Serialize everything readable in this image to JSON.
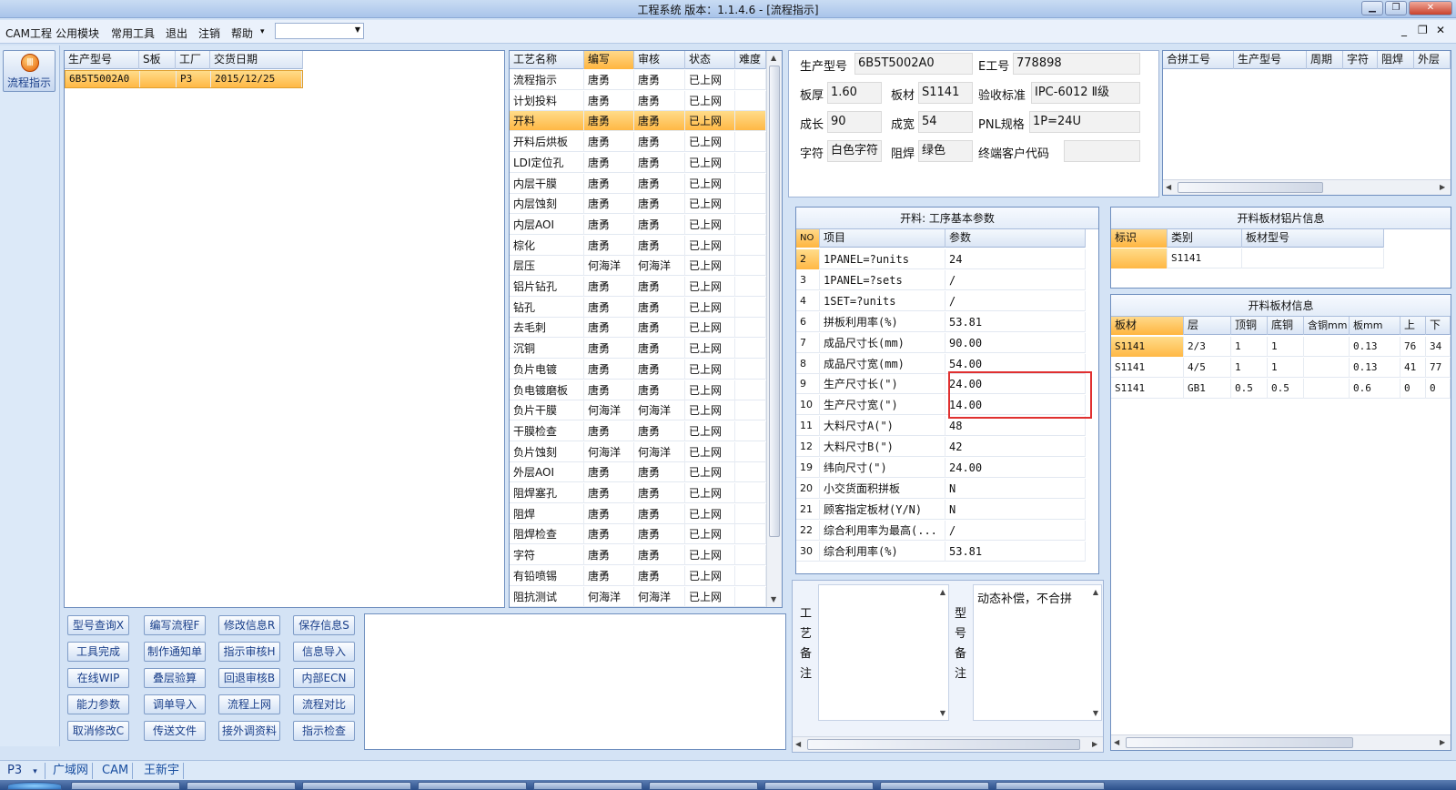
{
  "window": {
    "title": "工程系统   版本：1.1.4.6 - [流程指示]"
  },
  "menu": {
    "items": [
      "CAM工程",
      "公用模块",
      "常用工具",
      "退出",
      "注销",
      "帮助"
    ],
    "help_arrow": "▾",
    "combo_value": ""
  },
  "sidebar": {
    "flow_label": "流程指示"
  },
  "orders": {
    "columns": [
      "生产型号",
      "S板",
      "工厂",
      "交货日期"
    ],
    "rows": [
      {
        "model": "6B5T5002A0",
        "s": "",
        "factory": "P3",
        "date": "2015/12/25"
      }
    ]
  },
  "process": {
    "columns": [
      "工艺名称",
      "编写",
      "审核",
      "状态",
      "难度"
    ],
    "selected_index": 2,
    "rows": [
      [
        "流程指示",
        "唐勇",
        "唐勇",
        "已上网",
        ""
      ],
      [
        "计划投料",
        "唐勇",
        "唐勇",
        "已上网",
        ""
      ],
      [
        "开料",
        "唐勇",
        "唐勇",
        "已上网",
        ""
      ],
      [
        "开料后烘板",
        "唐勇",
        "唐勇",
        "已上网",
        ""
      ],
      [
        "LDI定位孔",
        "唐勇",
        "唐勇",
        "已上网",
        ""
      ],
      [
        "内层干膜",
        "唐勇",
        "唐勇",
        "已上网",
        ""
      ],
      [
        "内层蚀刻",
        "唐勇",
        "唐勇",
        "已上网",
        ""
      ],
      [
        "内层AOI",
        "唐勇",
        "唐勇",
        "已上网",
        ""
      ],
      [
        "棕化",
        "唐勇",
        "唐勇",
        "已上网",
        ""
      ],
      [
        "层压",
        "何海洋",
        "何海洋",
        "已上网",
        ""
      ],
      [
        "铝片钻孔",
        "唐勇",
        "唐勇",
        "已上网",
        ""
      ],
      [
        "钻孔",
        "唐勇",
        "唐勇",
        "已上网",
        ""
      ],
      [
        "去毛刺",
        "唐勇",
        "唐勇",
        "已上网",
        ""
      ],
      [
        "沉铜",
        "唐勇",
        "唐勇",
        "已上网",
        ""
      ],
      [
        "负片电镀",
        "唐勇",
        "唐勇",
        "已上网",
        ""
      ],
      [
        "负电镀磨板",
        "唐勇",
        "唐勇",
        "已上网",
        ""
      ],
      [
        "负片干膜",
        "何海洋",
        "何海洋",
        "已上网",
        ""
      ],
      [
        "干膜检查",
        "唐勇",
        "唐勇",
        "已上网",
        ""
      ],
      [
        "负片蚀刻",
        "何海洋",
        "何海洋",
        "已上网",
        ""
      ],
      [
        "外层AOI",
        "唐勇",
        "唐勇",
        "已上网",
        ""
      ],
      [
        "阻焊塞孔",
        "唐勇",
        "唐勇",
        "已上网",
        ""
      ],
      [
        "阻焊",
        "唐勇",
        "唐勇",
        "已上网",
        ""
      ],
      [
        "阻焊检查",
        "唐勇",
        "唐勇",
        "已上网",
        ""
      ],
      [
        "字符",
        "唐勇",
        "唐勇",
        "已上网",
        ""
      ],
      [
        "有铅喷锡",
        "唐勇",
        "唐勇",
        "已上网",
        ""
      ],
      [
        "阻抗测试",
        "何海洋",
        "何海洋",
        "已上网",
        ""
      ]
    ]
  },
  "info": {
    "model_label": "生产型号",
    "model": "6B5T5002A0",
    "eno_label": "E工号",
    "eno": "778898",
    "thick_label": "板厚",
    "thick": "1.60",
    "material_label": "板材",
    "material": "S1141",
    "standard_label": "验收标准",
    "standard": "IPC-6012 Ⅱ级",
    "len_label": "成长",
    "len": "90",
    "width_label": "成宽",
    "width": "54",
    "pnl_label": "PNL规格",
    "pnl": "1P=24U",
    "char_label": "字符",
    "char": "白色字符",
    "mask_label": "阻焊",
    "mask": "绿色",
    "cust_label": "终端客户代码",
    "cust": ""
  },
  "merge": {
    "columns": [
      "合拼工号",
      "生产型号",
      "周期",
      "字符",
      "阻焊",
      "外层"
    ]
  },
  "params": {
    "title": "开料: 工序基本参数",
    "columns": [
      "NO",
      "项目",
      "参数"
    ],
    "rows": [
      [
        "2",
        "1PANEL=?units",
        "24"
      ],
      [
        "3",
        "1PANEL=?sets",
        "/"
      ],
      [
        "4",
        "1SET=?units",
        "/"
      ],
      [
        "6",
        "拼板利用率(%)",
        "53.81"
      ],
      [
        "7",
        "成品尺寸长(mm)",
        "90.00"
      ],
      [
        "8",
        "成品尺寸宽(mm)",
        "54.00"
      ],
      [
        "9",
        "生产尺寸长(\")",
        "24.00"
      ],
      [
        "10",
        "生产尺寸宽(\")",
        "14.00"
      ],
      [
        "11",
        "大料尺寸A(\")",
        "48"
      ],
      [
        "12",
        "大料尺寸B(\")",
        "42"
      ],
      [
        "19",
        "纬向尺寸(\")",
        "24.00"
      ],
      [
        "20",
        "小交货面积拼板",
        "N"
      ],
      [
        "21",
        "顾客指定板材(Y/N)",
        "N"
      ],
      [
        "22",
        "综合利用率为最高(...",
        "/"
      ],
      [
        "30",
        "综合利用率(%)",
        "53.81"
      ]
    ]
  },
  "alu": {
    "title": "开料板材铝片信息",
    "columns": [
      "标识",
      "类别",
      "板材型号"
    ],
    "rows": [
      [
        "",
        "S1141",
        ""
      ]
    ]
  },
  "board": {
    "title": "开料板材信息",
    "columns": [
      "板材",
      "层",
      "顶铜",
      "底铜",
      "含铜mm",
      "板mm",
      "上",
      "下"
    ],
    "rows": [
      [
        "S1141",
        "2/3",
        "1",
        "1",
        "",
        "0.13",
        "76",
        "34"
      ],
      [
        "S1141",
        "4/5",
        "1",
        "1",
        "",
        "0.13",
        "41",
        "77"
      ],
      [
        "S1141",
        "GB1",
        "0.5",
        "0.5",
        "",
        "0.6",
        "0",
        "0"
      ]
    ]
  },
  "notes": {
    "process_label": "工艺备注",
    "model_label": "型号备注",
    "process_text": "",
    "model_text": "动态补偿，不合拼"
  },
  "buttons": [
    [
      "型号查询X",
      "编写流程F",
      "修改信息R",
      "保存信息S"
    ],
    [
      "工具完成",
      "制作通知单",
      "指示审核H",
      "信息导入"
    ],
    [
      "在线WIP",
      "叠层验算",
      "回退审核B",
      "内部ECN"
    ],
    [
      "能力参数",
      "调单导入",
      "流程上网",
      "流程对比"
    ],
    [
      "取消修改C",
      "传送文件",
      "接外调资料",
      "指示检查"
    ]
  ],
  "status": {
    "factory": "P3",
    "tabs": [
      "广域网",
      "CAM",
      "王新宇"
    ]
  },
  "colors": {
    "accent": "#ffcf66",
    "highlight_box": "#e03030"
  }
}
